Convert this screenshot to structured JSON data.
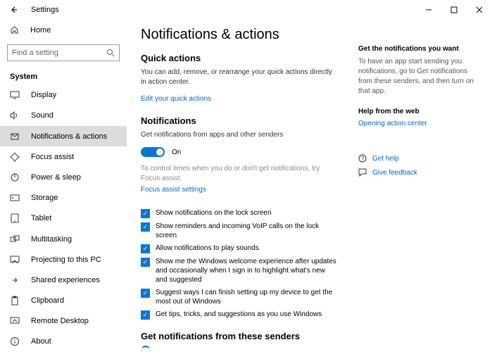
{
  "window": {
    "title": "Settings"
  },
  "sidebar": {
    "home": "Home",
    "search_placeholder": "Find a setting",
    "section": "System",
    "items": [
      {
        "label": "Display"
      },
      {
        "label": "Sound"
      },
      {
        "label": "Notifications & actions"
      },
      {
        "label": "Focus assist"
      },
      {
        "label": "Power & sleep"
      },
      {
        "label": "Storage"
      },
      {
        "label": "Tablet"
      },
      {
        "label": "Multitasking"
      },
      {
        "label": "Projecting to this PC"
      },
      {
        "label": "Shared experiences"
      },
      {
        "label": "Clipboard"
      },
      {
        "label": "Remote Desktop"
      },
      {
        "label": "About"
      }
    ]
  },
  "main": {
    "title": "Notifications & actions",
    "quick": {
      "heading": "Quick actions",
      "desc": "You can add, remove, or rearrange your quick actions directly in action center.",
      "link": "Edit your quick actions"
    },
    "notifications": {
      "heading": "Notifications",
      "toggle_desc": "Get notifications from apps and other senders",
      "toggle_state": "On",
      "hint": "To control times when you do or don't get notifications, try Focus assist.",
      "hint_link": "Focus assist settings",
      "checks": [
        "Show notifications on the lock screen",
        "Show reminders and incoming VoIP calls on the lock screen",
        "Allow notifications to play sounds",
        "Show me the Windows welcome experience after updates and occasionally when I sign in to highlight what's new and suggested",
        "Suggest ways I can finish setting up my device to get the most out of Windows",
        "Get tips, tricks, and suggestions as you use Windows"
      ]
    },
    "senders": {
      "heading": "Get notifications from these senders"
    }
  },
  "aside": {
    "h1": "Get the notifications you want",
    "p1": "To have an app start sending you notifications, go to Get notifications from these senders, and then turn on that app.",
    "h2": "Help from the web",
    "link1": "Opening action center",
    "help": "Get help",
    "feedback": "Give feedback"
  }
}
